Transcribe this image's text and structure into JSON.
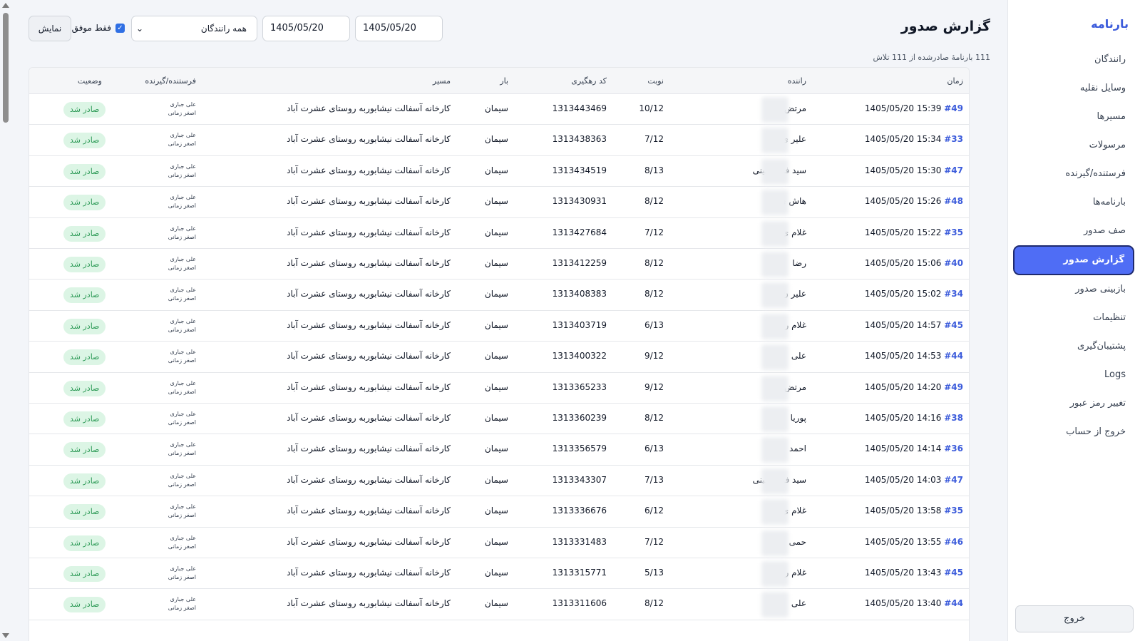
{
  "sidebar": {
    "brand": "بارنامه",
    "items": [
      {
        "label": "رانندگان",
        "active": false
      },
      {
        "label": "وسایل نقلیه",
        "active": false
      },
      {
        "label": "مسیرها",
        "active": false
      },
      {
        "label": "مرسولات",
        "active": false
      },
      {
        "label": "فرستنده/گیرنده",
        "active": false
      },
      {
        "label": "بارنامه‌ها",
        "active": false
      },
      {
        "label": "صف صدور",
        "active": false
      },
      {
        "label": "گزارش صدور",
        "active": true
      },
      {
        "label": "بازبینی صدور",
        "active": false
      },
      {
        "label": "تنظیمات",
        "active": false
      },
      {
        "label": "پشتیبان‌گیری",
        "active": false
      },
      {
        "label": "Logs",
        "active": false
      },
      {
        "label": "تغییر رمز عبور",
        "active": false
      },
      {
        "label": "خروج از حساب",
        "active": false
      }
    ],
    "logout_label": "خروج"
  },
  "header": {
    "title": "گزارش صدور",
    "summary": "111 بارنامهٔ صادرشده از 111 تلاش"
  },
  "filters": {
    "date_from": "1405/05/20",
    "date_to": "1405/05/20",
    "driver_select": "همه رانندگان",
    "only_success_label": "فقط موفق",
    "only_success_checked": true,
    "show_button": "نمایش"
  },
  "table": {
    "columns": {
      "time": "زمان",
      "driver": "راننده",
      "turn": "نوبت",
      "tracking": "کد رهگیری",
      "load": "بار",
      "route": "مسیر",
      "sender": "فرستنده/گیرنده",
      "status": "وضعیت"
    },
    "rows": [
      {
        "time": "1405/05/20 15:39",
        "num": "#49",
        "driver": "مرتض",
        "turn": "10/12",
        "tracking": "1313443469",
        "load": "سیمان",
        "route": "کارخانه آسفالت نیشابوربه روستای عشرت آباد",
        "sender": "علی جباری",
        "receiver": "اصغر زمانی",
        "status": "صادر شد"
      },
      {
        "time": "1405/05/20 15:34",
        "num": "#33",
        "driver": "علیر                ی",
        "turn": "7/12",
        "tracking": "1313438363",
        "load": "سیمان",
        "route": "کارخانه آسفالت نیشابوربه روستای عشرت آباد",
        "sender": "علی جباری",
        "receiver": "اصغر زمانی",
        "status": "صادر شد"
      },
      {
        "time": "1405/05/20 15:30",
        "num": "#47",
        "driver": "سید            فر حسینی",
        "turn": "8/13",
        "tracking": "1313434519",
        "load": "سیمان",
        "route": "کارخانه آسفالت نیشابوربه روستای عشرت آباد",
        "sender": "علی جباری",
        "receiver": "اصغر زمانی",
        "status": "صادر شد"
      },
      {
        "time": "1405/05/20 15:26",
        "num": "#48",
        "driver": "هاش                ی",
        "turn": "8/12",
        "tracking": "1313430931",
        "load": "سیمان",
        "route": "کارخانه آسفالت نیشابوربه روستای عشرت آباد",
        "sender": "علی جباری",
        "receiver": "اصغر زمانی",
        "status": "صادر شد"
      },
      {
        "time": "1405/05/20 15:22",
        "num": "#35",
        "driver": "غلام                ی",
        "turn": "7/12",
        "tracking": "1313427684",
        "load": "سیمان",
        "route": "کارخانه آسفالت نیشابوربه روستای عشرت آباد",
        "sender": "علی جباری",
        "receiver": "اصغر زمانی",
        "status": "صادر شد"
      },
      {
        "time": "1405/05/20 15:06",
        "num": "#40",
        "driver": "رضا",
        "turn": "8/12",
        "tracking": "1313412259",
        "load": "سیمان",
        "route": "کارخانه آسفالت نیشابوربه روستای عشرت آباد",
        "sender": "علی جباری",
        "receiver": "اصغر زمانی",
        "status": "صادر شد"
      },
      {
        "time": "1405/05/20 15:02",
        "num": "#34",
        "driver": "علیر                ن",
        "turn": "8/12",
        "tracking": "1313408383",
        "load": "سیمان",
        "route": "کارخانه آسفالت نیشابوربه روستای عشرت آباد",
        "sender": "علی جباری",
        "receiver": "اصغر زمانی",
        "status": "صادر شد"
      },
      {
        "time": "1405/05/20 14:57",
        "num": "#45",
        "driver": "غلام            رخیز",
        "turn": "6/13",
        "tracking": "1313403719",
        "load": "سیمان",
        "route": "کارخانه آسفالت نیشابوربه روستای عشرت آباد",
        "sender": "علی جباری",
        "receiver": "اصغر زمانی",
        "status": "صادر شد"
      },
      {
        "time": "1405/05/20 14:53",
        "num": "#44",
        "driver": "علی",
        "turn": "9/12",
        "tracking": "1313400322",
        "load": "سیمان",
        "route": "کارخانه آسفالت نیشابوربه روستای عشرت آباد",
        "sender": "علی جباری",
        "receiver": "اصغر زمانی",
        "status": "صادر شد"
      },
      {
        "time": "1405/05/20 14:20",
        "num": "#49",
        "driver": "مرتض                ی",
        "turn": "9/12",
        "tracking": "1313365233",
        "load": "سیمان",
        "route": "کارخانه آسفالت نیشابوربه روستای عشرت آباد",
        "sender": "علی جباری",
        "receiver": "اصغر زمانی",
        "status": "صادر شد"
      },
      {
        "time": "1405/05/20 14:16",
        "num": "#38",
        "driver": "پوریا",
        "turn": "8/12",
        "tracking": "1313360239",
        "load": "سیمان",
        "route": "کارخانه آسفالت نیشابوربه روستای عشرت آباد",
        "sender": "علی جباری",
        "receiver": "اصغر زمانی",
        "status": "صادر شد"
      },
      {
        "time": "1405/05/20 14:14",
        "num": "#36",
        "driver": "احمد",
        "turn": "6/13",
        "tracking": "1313356579",
        "load": "سیمان",
        "route": "کارخانه آسفالت نیشابوربه روستای عشرت آباد",
        "sender": "علی جباری",
        "receiver": "اصغر زمانی",
        "status": "صادر شد"
      },
      {
        "time": "1405/05/20 14:03",
        "num": "#47",
        "driver": "سید            فر حسینی",
        "turn": "7/13",
        "tracking": "1313343307",
        "load": "سیمان",
        "route": "کارخانه آسفالت نیشابوربه روستای عشرت آباد",
        "sender": "علی جباری",
        "receiver": "اصغر زمانی",
        "status": "صادر شد"
      },
      {
        "time": "1405/05/20 13:58",
        "num": "#35",
        "driver": "غلام                ی",
        "turn": "6/12",
        "tracking": "1313336676",
        "load": "سیمان",
        "route": "کارخانه آسفالت نیشابوربه روستای عشرت آباد",
        "sender": "علی جباری",
        "receiver": "اصغر زمانی",
        "status": "صادر شد"
      },
      {
        "time": "1405/05/20 13:55",
        "num": "#46",
        "driver": "حمی",
        "turn": "7/12",
        "tracking": "1313331483",
        "load": "سیمان",
        "route": "کارخانه آسفالت نیشابوربه روستای عشرت آباد",
        "sender": "علی جباری",
        "receiver": "اصغر زمانی",
        "status": "صادر شد"
      },
      {
        "time": "1405/05/20 13:43",
        "num": "#45",
        "driver": "غلام            رخیز",
        "turn": "5/13",
        "tracking": "1313315771",
        "load": "سیمان",
        "route": "کارخانه آسفالت نیشابوربه روستای عشرت آباد",
        "sender": "علی جباری",
        "receiver": "اصغر زمانی",
        "status": "صادر شد"
      },
      {
        "time": "1405/05/20 13:40",
        "num": "#44",
        "driver": "علی",
        "turn": "8/12",
        "tracking": "1313311606",
        "load": "سیمان",
        "route": "کارخانه آسفالت نیشابوربه روستای عشرت آباد",
        "sender": "علی جباری",
        "receiver": "اصغر زمانی",
        "status": "صادر شد"
      }
    ]
  },
  "colors": {
    "accent": "#4f6df5",
    "link": "#3b5bdb",
    "success_bg": "#dcf5e5",
    "success_text": "#2f9b58"
  }
}
